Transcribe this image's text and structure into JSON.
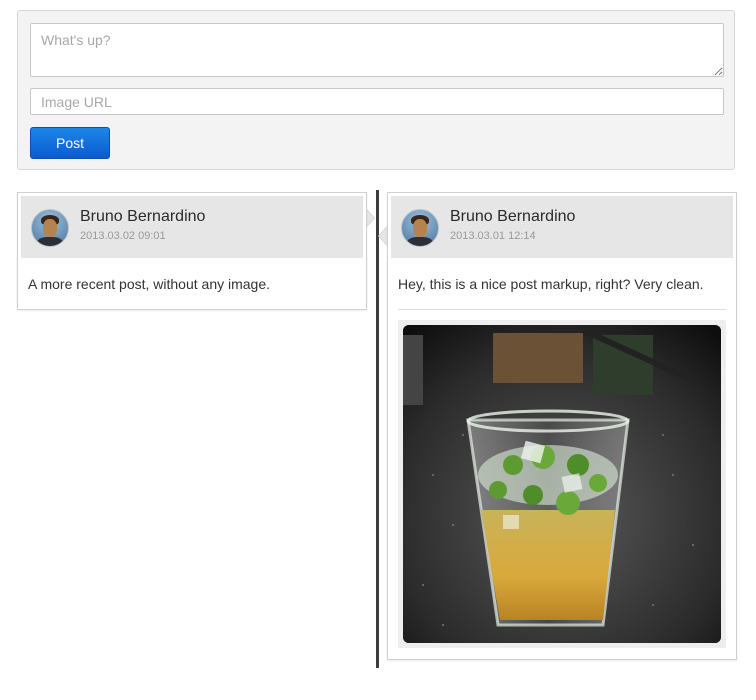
{
  "composer": {
    "message_placeholder": "What's up?",
    "image_url_placeholder": "Image URL",
    "post_label": "Post"
  },
  "posts": [
    {
      "author": "Bruno Bernardino",
      "timestamp": "2013.03.02 09:01",
      "text": "A more recent post, without any image."
    },
    {
      "author": "Bruno Bernardino",
      "timestamp": "2013.03.01 12:14",
      "text": "Hey, this is a nice post markup, right? Very clean.",
      "image": "mojito-glass-photo"
    }
  ],
  "colors": {
    "post_button": "#0b5bd0",
    "timeline_line": "#3c3c3c",
    "card_header": "#e6e6e6"
  }
}
